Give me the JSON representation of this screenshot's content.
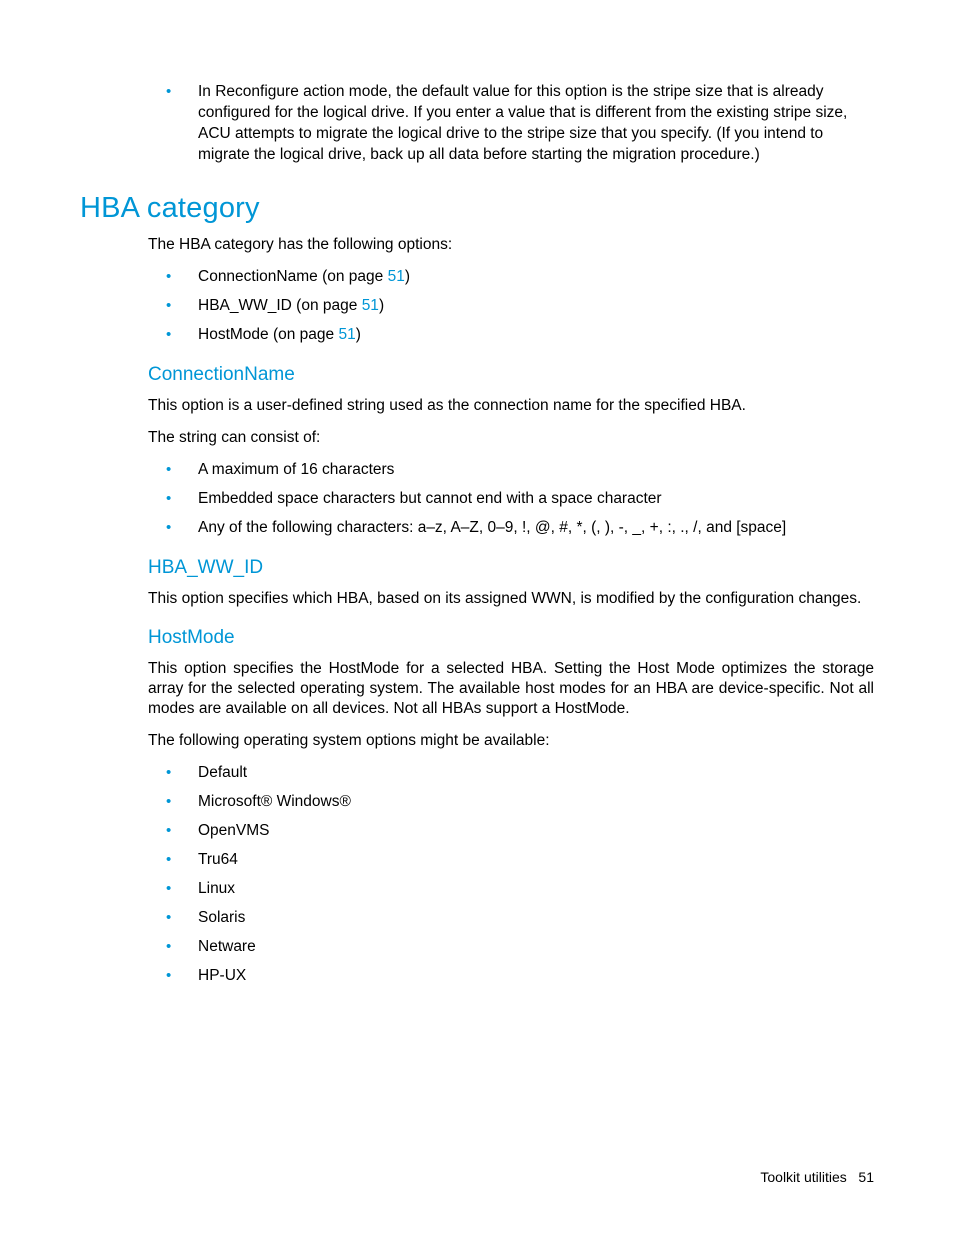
{
  "intro_bullet": "In Reconfigure action mode, the default value for this option is the stripe size that is already configured for the logical drive. If you enter a value that is different from the existing stripe size, ACU attempts to migrate the logical drive to the stripe size that you specify. (If you intend to migrate the logical drive, back up all data before starting the migration procedure.)",
  "h1": "HBA category",
  "hba_intro": "The HBA category has the following options:",
  "hba_options": [
    {
      "prefix": "ConnectionName (on page ",
      "page": "51",
      "suffix": ")"
    },
    {
      "prefix": "HBA_WW_ID (on page ",
      "page": "51",
      "suffix": ")"
    },
    {
      "prefix": "HostMode (on page ",
      "page": "51",
      "suffix": ")"
    }
  ],
  "cn": {
    "heading": "ConnectionName",
    "p1": "This option is a user-defined string used as the connection name for the specified HBA.",
    "p2": "The string can consist of:",
    "items": [
      "A maximum of 16 characters",
      "Embedded space characters but cannot end with a space character",
      "Any of the following characters: a–z, A–Z, 0–9, !, @, #, *, (, ), -, _, +, :, ., /, and [space]"
    ]
  },
  "hw": {
    "heading": "HBA_WW_ID",
    "p1": "This option specifies which HBA, based on its assigned WWN, is modified by the configuration changes."
  },
  "hm": {
    "heading": "HostMode",
    "p1": "This option specifies the HostMode for a selected HBA. Setting the Host Mode optimizes the storage array for the selected operating system. The available host modes for an HBA are device-specific. Not all modes are available on all devices. Not all HBAs support a HostMode.",
    "p2": "The following operating system options might be available:",
    "items": [
      "Default",
      "Microsoft® Windows®",
      "OpenVMS",
      "Tru64",
      "Linux",
      "Solaris",
      "Netware",
      "HP-UX"
    ]
  },
  "footer": {
    "label": "Toolkit utilities",
    "page": "51"
  }
}
